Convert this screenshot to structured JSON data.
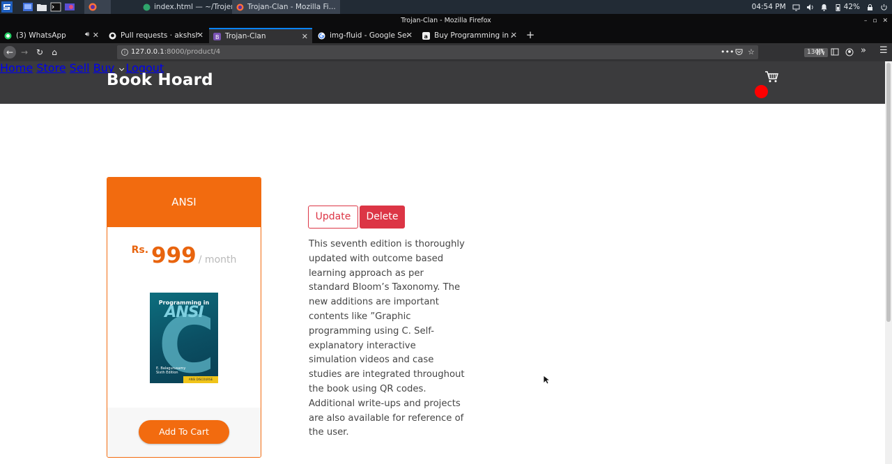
{
  "taskbar": {
    "windows": [
      {
        "label": "index.html — ~/Trojen/..."
      },
      {
        "label": "Trojan-Clan - Mozilla Fi..."
      }
    ],
    "clock": "04:54 PM",
    "battery": "42%"
  },
  "browser": {
    "title": "Trojan-Clan - Mozilla Firefox",
    "tabs": [
      {
        "label": "(3) WhatsApp"
      },
      {
        "label": "Pull requests · akshsharm"
      },
      {
        "label": "Trojan-Clan"
      },
      {
        "label": "img-fluid - Google Searc"
      },
      {
        "label": "Buy Programming in ANSI"
      }
    ],
    "url_host": "127.0.0.1",
    "url_rest": ":8000/product/4",
    "zoom": "130%",
    "page_actions_icon": "•••"
  },
  "site": {
    "brand": "Book Hoard",
    "nav": {
      "home": "Home",
      "store": "Store",
      "sell": "Sell",
      "buy": "Buy",
      "logout": "Logout"
    }
  },
  "product": {
    "title": "ANSI",
    "currency": "Rs.",
    "price": "999",
    "period": "/ month",
    "cover": {
      "line1": "Programming in",
      "line2": "ANSI",
      "letter": "C",
      "author": "E. Balagurusamy",
      "edition": "Sixth Edition",
      "strip": "ANSI DISCOURSE EDITION"
    },
    "add_to_cart": "Add To Cart",
    "update": "Update",
    "delete": "Delete",
    "description": "This seventh edition is thoroughly updated with outcome based learning approach as per standard Bloom’s Taxonomy. The new additions are important contents like ”Graphic programming using C. Self-explanatory interactive simulation videos and case studies are integrated throughout the book using QR codes. Additional write-ups and projects are also available for reference of the user."
  }
}
